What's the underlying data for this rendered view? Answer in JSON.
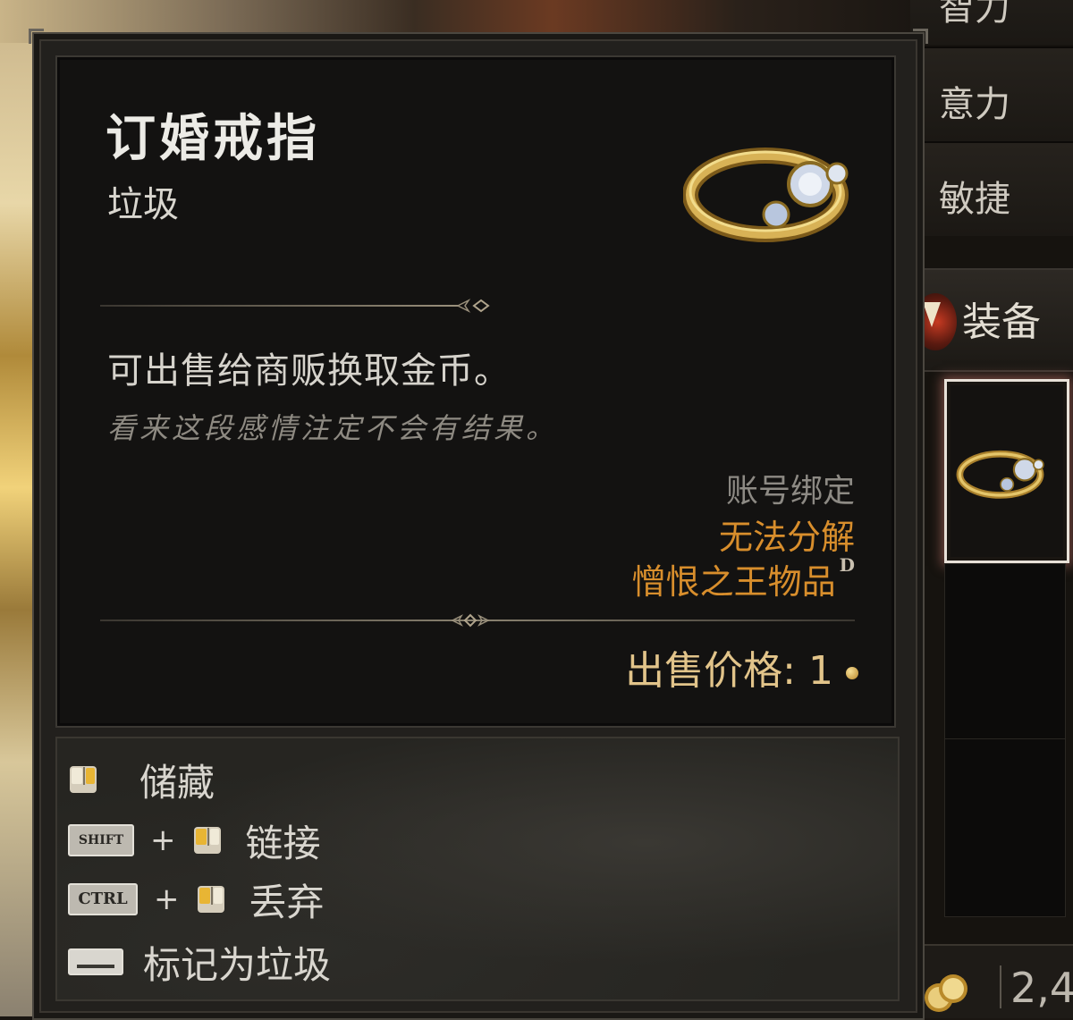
{
  "tooltip": {
    "item_name": "订婚戒指",
    "item_type": "垃圾",
    "description": "可出售给商贩换取金币。",
    "flavor_text": "看来这段感情注定不会有结果。",
    "binding": "账号绑定",
    "salvage_note": "无法分解",
    "vessel_tag": "憎恨之王物品",
    "vessel_mark": "D",
    "sell_price_label": "出售价格:",
    "sell_price_value": "1",
    "colors": {
      "title": "#ecebe6",
      "orange_tag": "#d88e2c",
      "price": "#e2c48a",
      "flavor": "#8e8a82"
    }
  },
  "actions": [
    {
      "keys": [],
      "mouse": "right-click-icon",
      "label": "储藏"
    },
    {
      "keys": [
        "SHIFT"
      ],
      "mouse": "left-click-icon",
      "label": "链接"
    },
    {
      "keys": [
        "CTRL"
      ],
      "mouse": "left-click-icon",
      "label": "丢弃"
    },
    {
      "keys": [
        "space-key-icon"
      ],
      "mouse": null,
      "label": "标记为垃圾"
    }
  ],
  "plus_sign": "+",
  "side_panel": {
    "stats": [
      "智力",
      "意力",
      "敏捷"
    ],
    "equip_tab": "装备",
    "gold": "2,4"
  }
}
